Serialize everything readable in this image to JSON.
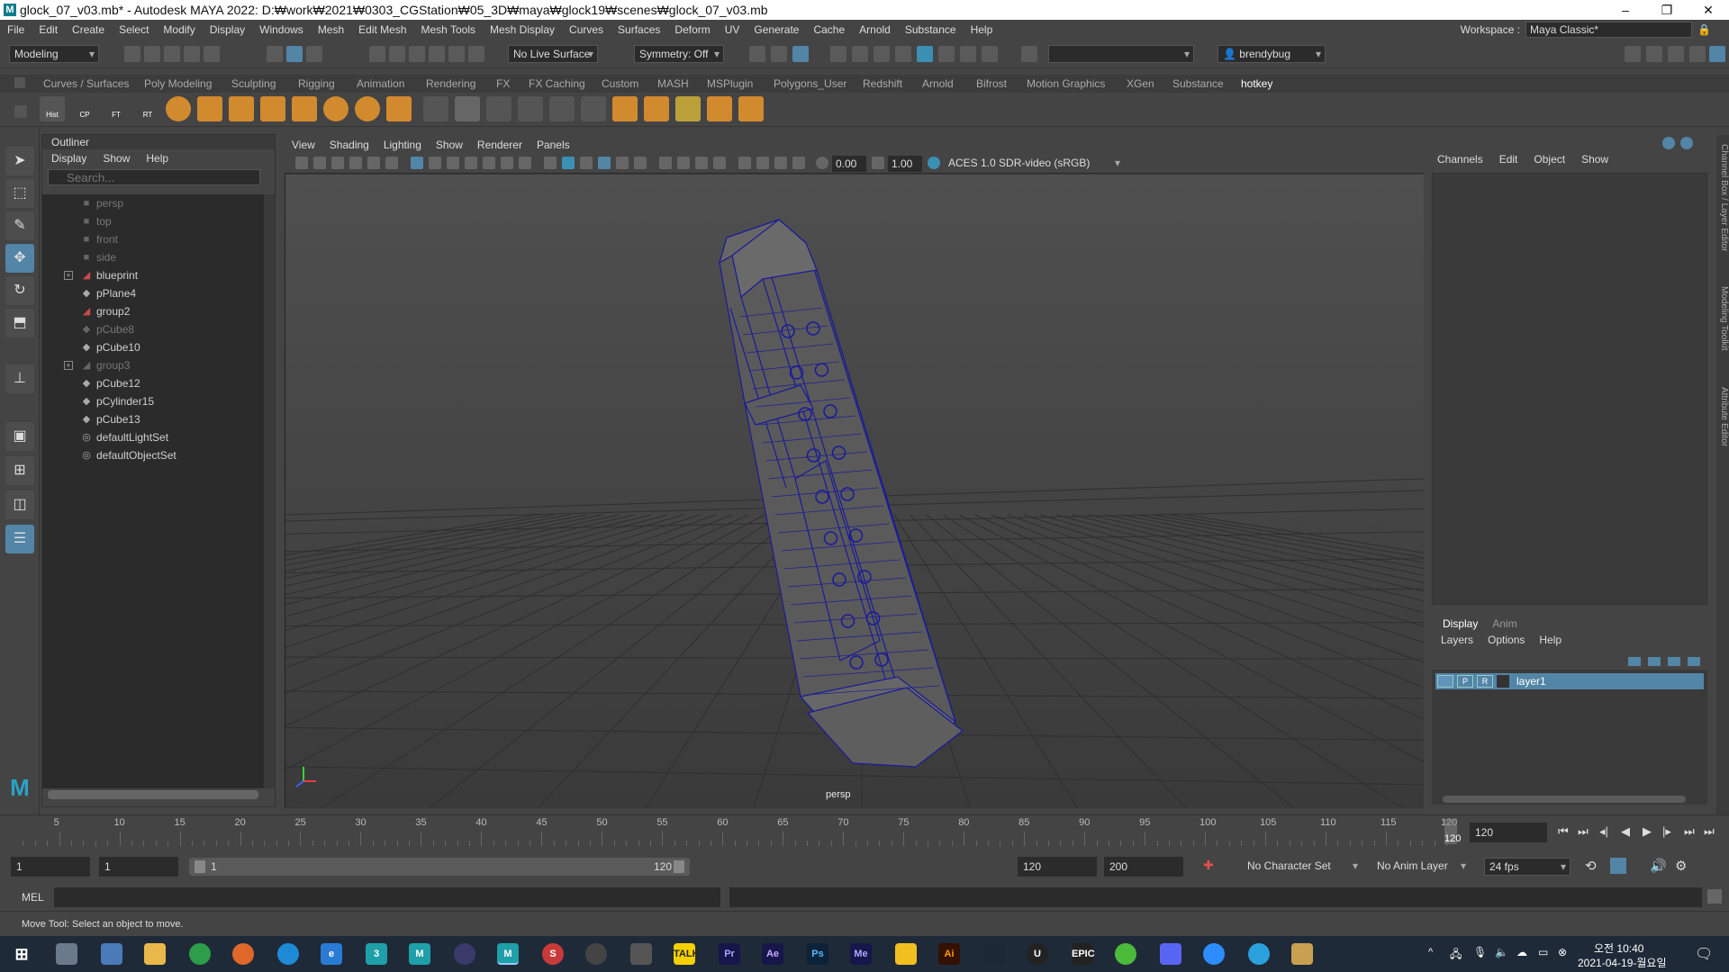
{
  "window": {
    "title": "glock_07_v03.mb* - Autodesk MAYA 2022: D:₩work₩2021₩0303_CGStation₩05_3D₩maya₩glock19₩scenes₩glock_07_v03.mb",
    "minimize": "–",
    "maximize": "❐",
    "close": "✕"
  },
  "menubar": {
    "items": [
      "File",
      "Edit",
      "Create",
      "Select",
      "Modify",
      "Display",
      "Windows",
      "Mesh",
      "Edit Mesh",
      "Mesh Tools",
      "Mesh Display",
      "Curves",
      "Surfaces",
      "Deform",
      "UV",
      "Generate",
      "Cache",
      "Arnold",
      "Substance",
      "Help"
    ],
    "workspace_label": "Workspace :",
    "workspace_value": "Maya Classic*"
  },
  "statusline": {
    "mode": "Modeling",
    "live_surface": "No Live Surface",
    "symmetry": "Symmetry: Off",
    "user": "brendybug"
  },
  "shelf": {
    "tabs": [
      "Curves / Surfaces",
      "Poly Modeling",
      "Sculpting",
      "Rigging",
      "Animation",
      "Rendering",
      "FX",
      "FX Caching",
      "Custom",
      "MASH",
      "MSPlugin",
      "Polygons_User",
      "Redshift",
      "Arnold",
      "Bifrost",
      "Motion Graphics",
      "XGen",
      "Substance",
      "hotkey"
    ],
    "active_tab": "hotkey",
    "icon_labels": [
      "Hist",
      "CP",
      "FT",
      "RT"
    ]
  },
  "outliner": {
    "title": "Outliner",
    "menu": [
      "Display",
      "Show",
      "Help"
    ],
    "search_placeholder": "Search...",
    "items": [
      {
        "label": "persp",
        "icon": "camera-icon",
        "dim": true,
        "expandable": false
      },
      {
        "label": "top",
        "icon": "camera-icon",
        "dim": true,
        "expandable": false
      },
      {
        "label": "front",
        "icon": "camera-icon",
        "dim": true,
        "expandable": false
      },
      {
        "label": "side",
        "icon": "camera-icon",
        "dim": true,
        "expandable": false
      },
      {
        "label": "blueprint",
        "icon": "group-icon",
        "dim": false,
        "expandable": true
      },
      {
        "label": "pPlane4",
        "icon": "mesh-icon",
        "dim": false,
        "expandable": false
      },
      {
        "label": "group2",
        "icon": "group-icon",
        "dim": false,
        "expandable": false
      },
      {
        "label": "pCube8",
        "icon": "mesh-icon",
        "dim": true,
        "expandable": false
      },
      {
        "label": "pCube10",
        "icon": "mesh-icon",
        "dim": false,
        "expandable": false
      },
      {
        "label": "group3",
        "icon": "group-icon",
        "dim": true,
        "expandable": true
      },
      {
        "label": "pCube12",
        "icon": "mesh-icon",
        "dim": false,
        "expandable": false
      },
      {
        "label": "pCylinder15",
        "icon": "mesh-icon",
        "dim": false,
        "expandable": false
      },
      {
        "label": "pCube13",
        "icon": "mesh-icon",
        "dim": false,
        "expandable": false
      },
      {
        "label": "defaultLightSet",
        "icon": "set-icon",
        "dim": false,
        "expandable": false
      },
      {
        "label": "defaultObjectSet",
        "icon": "set-icon",
        "dim": false,
        "expandable": false
      }
    ]
  },
  "viewport": {
    "menu": [
      "View",
      "Shading",
      "Lighting",
      "Show",
      "Renderer",
      "Panels"
    ],
    "exposure": "0.00",
    "gamma": "1.00",
    "color_space": "ACES 1.0 SDR-video (sRGB)",
    "camera_label": "persp"
  },
  "channelbox": {
    "menu": [
      "Channels",
      "Edit",
      "Object",
      "Show"
    ]
  },
  "layers": {
    "tabs": [
      "Display",
      "Anim"
    ],
    "menu": [
      "Layers",
      "Options",
      "Help"
    ],
    "row": {
      "p": "P",
      "r": "R",
      "name": "layer1"
    }
  },
  "sidetabs": [
    "Channel Box / Layer Editor",
    "Modeling Toolkit",
    "Attribute Editor"
  ],
  "timeline": {
    "ticks": [
      "5",
      "10",
      "15",
      "20",
      "25",
      "30",
      "35",
      "40",
      "45",
      "50",
      "55",
      "60",
      "65",
      "70",
      "75",
      "80",
      "85",
      "90",
      "95",
      "100",
      "105",
      "110",
      "115",
      "120"
    ],
    "current_frame": "120",
    "current_field": "120"
  },
  "range": {
    "start": "1",
    "start2": "1",
    "slider_start": "1",
    "slider_end": "120",
    "end": "120",
    "end2": "200",
    "character_set": "No Character Set",
    "anim_layer": "No Anim Layer",
    "fps": "24 fps"
  },
  "cmdline": {
    "label": "MEL"
  },
  "helpline": {
    "text": "Move Tool: Select an object to move."
  },
  "taskbar": {
    "time": "오전 10:40",
    "date": "2021-04-19-월요일"
  }
}
